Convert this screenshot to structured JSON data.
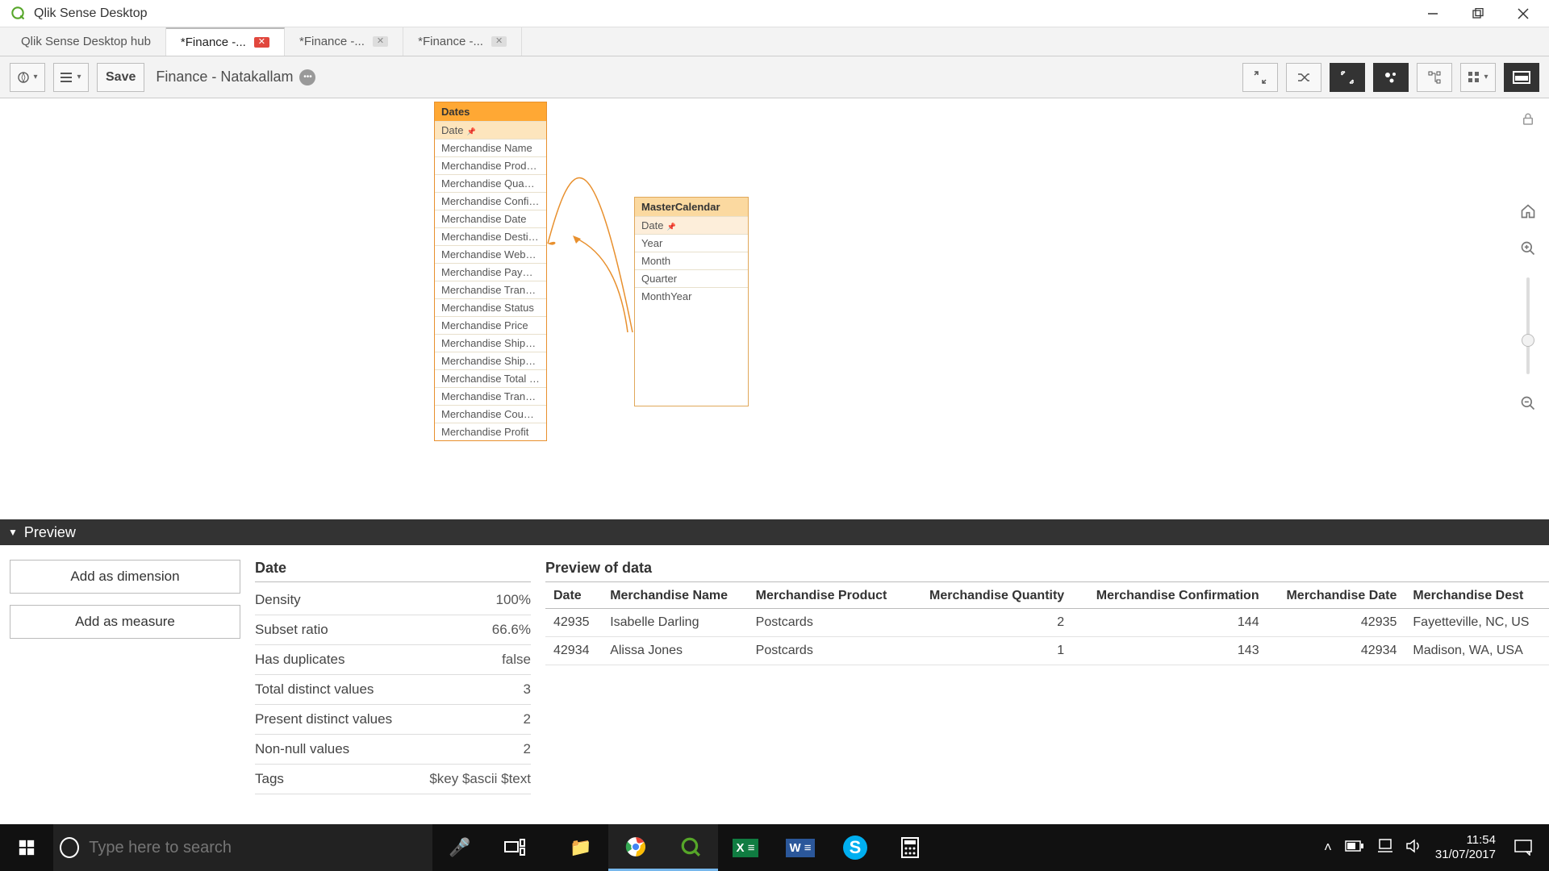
{
  "window": {
    "title": "Qlik Sense Desktop"
  },
  "tabs": [
    {
      "label": "Qlik Sense Desktop hub",
      "closable": false,
      "active": false
    },
    {
      "label": "*Finance -...",
      "closable": true,
      "active": true,
      "red_close": true
    },
    {
      "label": "*Finance -...",
      "closable": true,
      "active": false
    },
    {
      "label": "*Finance -...",
      "closable": true,
      "active": false
    }
  ],
  "toolbar": {
    "save_label": "Save",
    "app_name": "Finance - Natakallam"
  },
  "model": {
    "dates_table": {
      "title": "Dates",
      "key_field": "Date",
      "fields": [
        "Merchandise Name",
        "Merchandise Product",
        "Merchandise Quantity",
        "Merchandise Confir...",
        "Merchandise Date",
        "Merchandise Destina...",
        "Merchandise Website",
        "Merchandise Payme...",
        "Merchandise Transfe...",
        "Merchandise Status",
        "Merchandise Price",
        "Merchandise Shippin...",
        "Merchandise Shippin...",
        "Merchandise Total R...",
        "Merchandise Transa...",
        "Merchandise Country",
        "Merchandise Profit"
      ]
    },
    "calendar_table": {
      "title": "MasterCalendar",
      "key_field": "Date",
      "fields": [
        "Year",
        "Month",
        "Quarter",
        "MonthYear"
      ]
    }
  },
  "preview": {
    "header": "Preview",
    "add_dimension": "Add as dimension",
    "add_measure": "Add as measure",
    "field_name": "Date",
    "stats": {
      "density_label": "Density",
      "density_value": "100%",
      "subset_label": "Subset ratio",
      "subset_value": "66.6%",
      "dup_label": "Has duplicates",
      "dup_value": "false",
      "total_label": "Total distinct values",
      "total_value": "3",
      "present_label": "Present distinct values",
      "present_value": "2",
      "nonnull_label": "Non-null values",
      "nonnull_value": "2",
      "tags_label": "Tags",
      "tags_value": "$key $ascii $text"
    },
    "data_title": "Preview of data",
    "columns": [
      "Date",
      "Merchandise Name",
      "Merchandise Product",
      "Merchandise Quantity",
      "Merchandise Confirmation",
      "Merchandise Date",
      "Merchandise Dest"
    ],
    "rows": [
      {
        "date": "42935",
        "name": "Isabelle Darling",
        "product": "Postcards",
        "qty": "2",
        "conf": "144",
        "mdate": "42935",
        "dest": "Fayetteville, NC, US"
      },
      {
        "date": "42934",
        "name": "Alissa Jones",
        "product": "Postcards",
        "qty": "1",
        "conf": "143",
        "mdate": "42934",
        "dest": "Madison, WA, USA"
      }
    ]
  },
  "taskbar": {
    "search_placeholder": "Type here to search",
    "time": "11:54",
    "date": "31/07/2017"
  }
}
